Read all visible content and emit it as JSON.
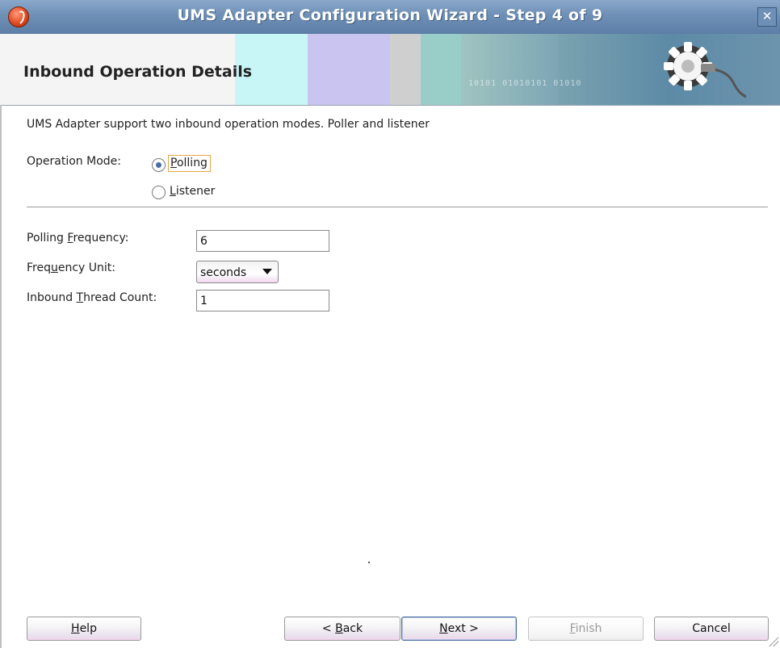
{
  "window": {
    "title": "UMS Adapter Configuration Wizard - Step 4 of 9",
    "close_symbol": "✕",
    "app_icon": "oracle-jdeveloper-icon"
  },
  "banner": {
    "title": "Inbound Operation Details",
    "binary_text": "10101 01010101 01010",
    "art_icon": "gear-plug-icon"
  },
  "content": {
    "intro": "UMS Adapter support two inbound operation modes. Poller and listener",
    "operation_mode_label": "Operation Mode:",
    "modes": [
      {
        "label_mnemonic": "P",
        "label_rest": "olling",
        "selected": true
      },
      {
        "label_mnemonic": "L",
        "label_rest": "istener",
        "selected": false
      }
    ],
    "fields": {
      "polling_frequency": {
        "label_pre": "Polling ",
        "label_mnemonic": "F",
        "label_post": "requency:",
        "value": "6"
      },
      "frequency_unit": {
        "label_pre": "Freq",
        "label_mnemonic": "u",
        "label_post": "ency Unit:",
        "value": "seconds"
      },
      "thread_count": {
        "label_pre": "Inbound ",
        "label_mnemonic": "T",
        "label_post": "hread Count:",
        "value": "1"
      }
    }
  },
  "buttons": {
    "help": {
      "mnemonic": "H",
      "rest": "elp"
    },
    "back": {
      "pre": "< ",
      "mnemonic": "B",
      "rest": "ack"
    },
    "next": {
      "mnemonic": "N",
      "rest": "ext >"
    },
    "finish": {
      "mnemonic": "F",
      "rest": "inish",
      "enabled": false
    },
    "cancel": {
      "label": "Cancel"
    }
  },
  "colors": {
    "titlebar": "#6e8fb6",
    "focus_outline": "#e9a449",
    "radio_dot": "#4a6fa8"
  }
}
